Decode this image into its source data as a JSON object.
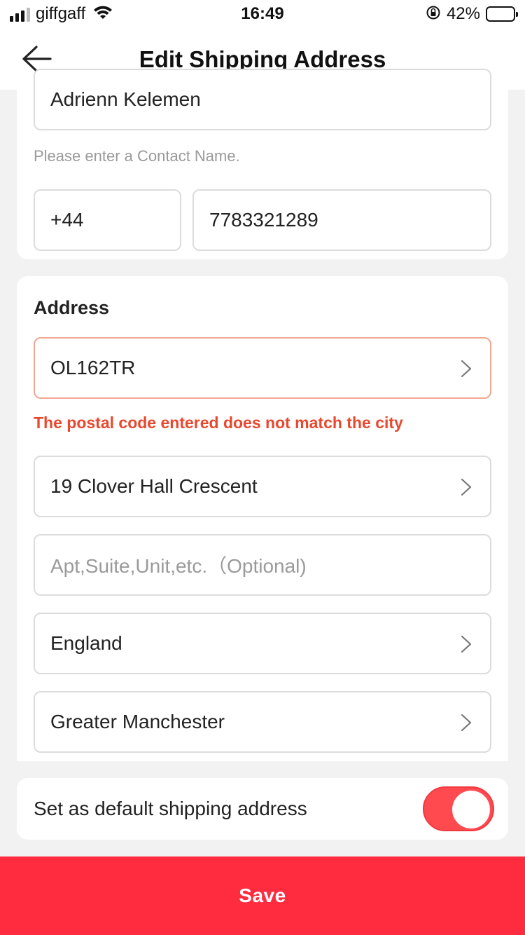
{
  "status_bar": {
    "carrier": "giffgaff",
    "time": "16:49",
    "battery_percent": "42%",
    "battery_level": 0.42,
    "signal_bars": 3
  },
  "header": {
    "title": "Edit Shipping Address",
    "back_icon": "arrow-left-icon"
  },
  "contact": {
    "name_value": "Adrienn Kelemen",
    "name_hint": "Please enter a Contact Name.",
    "country_code": "+44",
    "phone_number": "7783321289"
  },
  "address": {
    "section_title": "Address",
    "postcode_value": "OL162TR",
    "postcode_error": "The postal code entered does not match the city",
    "street_value": "19 Clover Hall Crescent",
    "apt_placeholder": "Apt,Suite,Unit,etc.（Optional)",
    "region_value": "England",
    "county_value": "Greater Manchester"
  },
  "default_address": {
    "label": "Set as default shipping address",
    "enabled": true
  },
  "save": {
    "label": "Save"
  },
  "colors": {
    "accent": "#ff2b3f",
    "toggle": "#ff4a50",
    "error": "#e8482f",
    "error_border": "#f2a792"
  }
}
